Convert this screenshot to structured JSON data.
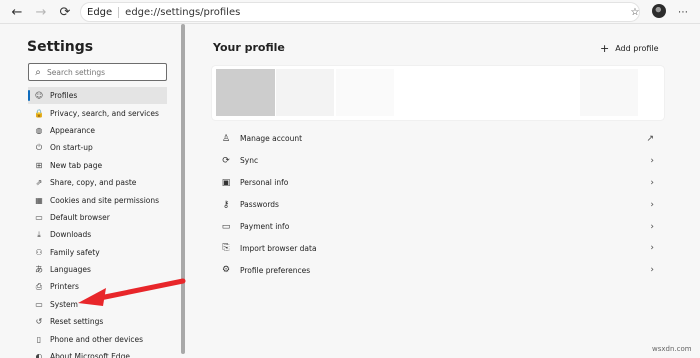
{
  "toolbar": {
    "site_label": "Edge",
    "url": "edge://settings/profiles"
  },
  "sidebar": {
    "title": "Settings",
    "search_placeholder": "Search settings",
    "items": [
      {
        "label": "Profiles",
        "icon": "profile-icon",
        "glyph": "☺",
        "active": true
      },
      {
        "label": "Privacy, search, and services",
        "icon": "lock-icon",
        "glyph": "🔒"
      },
      {
        "label": "Appearance",
        "icon": "appearance-icon",
        "glyph": "◍"
      },
      {
        "label": "On start-up",
        "icon": "power-icon",
        "glyph": "⏻"
      },
      {
        "label": "New tab page",
        "icon": "new-tab-icon",
        "glyph": "⊞"
      },
      {
        "label": "Share, copy, and paste",
        "icon": "share-icon",
        "glyph": "⇗"
      },
      {
        "label": "Cookies and site permissions",
        "icon": "cookie-icon",
        "glyph": "▦"
      },
      {
        "label": "Default browser",
        "icon": "browser-icon",
        "glyph": "▭"
      },
      {
        "label": "Downloads",
        "icon": "download-icon",
        "glyph": "⤓"
      },
      {
        "label": "Family safety",
        "icon": "family-icon",
        "glyph": "⚇"
      },
      {
        "label": "Languages",
        "icon": "languages-icon",
        "glyph": "あ"
      },
      {
        "label": "Printers",
        "icon": "printer-icon",
        "glyph": "⎙"
      },
      {
        "label": "System",
        "icon": "system-icon",
        "glyph": "▭"
      },
      {
        "label": "Reset settings",
        "icon": "reset-icon",
        "glyph": "↺"
      },
      {
        "label": "Phone and other devices",
        "icon": "phone-icon",
        "glyph": "▯"
      },
      {
        "label": "About Microsoft Edge",
        "icon": "edge-icon",
        "glyph": "◐"
      }
    ]
  },
  "main": {
    "title": "Your profile",
    "add_profile_label": "Add profile",
    "rows": [
      {
        "label": "Manage account",
        "icon": "account-icon",
        "glyph": "♙",
        "action": "external-link-icon",
        "action_glyph": "↗"
      },
      {
        "label": "Sync",
        "icon": "sync-icon",
        "glyph": "⟳",
        "action": "chevron-right-icon",
        "action_glyph": "›"
      },
      {
        "label": "Personal info",
        "icon": "personal-info-icon",
        "glyph": "▣",
        "action": "chevron-right-icon",
        "action_glyph": "›"
      },
      {
        "label": "Passwords",
        "icon": "key-icon",
        "glyph": "⚷",
        "action": "chevron-right-icon",
        "action_glyph": "›"
      },
      {
        "label": "Payment info",
        "icon": "card-icon",
        "glyph": "▭",
        "action": "chevron-right-icon",
        "action_glyph": "›"
      },
      {
        "label": "Import browser data",
        "icon": "import-icon",
        "glyph": "⎘",
        "action": "chevron-right-icon",
        "action_glyph": "›"
      },
      {
        "label": "Profile preferences",
        "icon": "preferences-icon",
        "glyph": "⚙",
        "action": "chevron-right-icon",
        "action_glyph": "›"
      }
    ]
  },
  "annotation": {
    "color": "#e8262a"
  },
  "watermark": "wsxdn.com",
  "colors": {
    "accent": "#0f6cbd",
    "background": "#f7f7f7",
    "card": "#ffffff"
  }
}
